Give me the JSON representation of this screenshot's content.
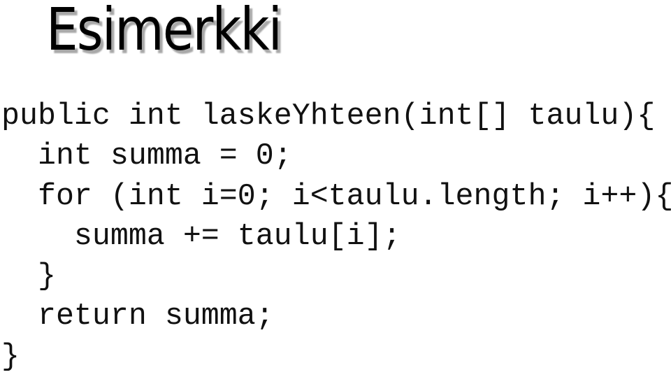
{
  "slide": {
    "title": "Esimerkki",
    "code_lines": [
      "public int laskeYhteen(int[] taulu){",
      "  int summa = 0;",
      "  for (int i=0; i<taulu.length; i++){",
      "    summa += taulu[i];",
      "  }",
      "  return summa;",
      "}"
    ]
  }
}
